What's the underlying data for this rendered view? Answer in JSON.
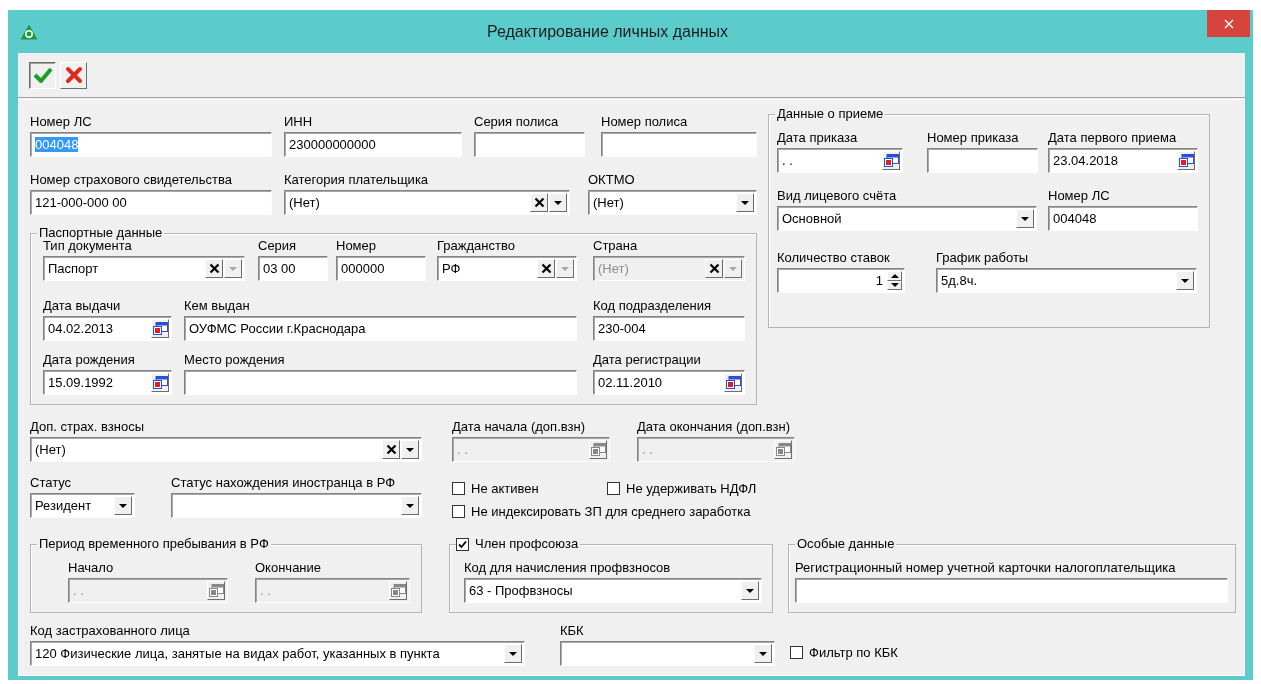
{
  "window": {
    "title": "Редактирование личных данных"
  },
  "main": {
    "lines": [
      {
        "fields": [
          {
            "kind": "text",
            "label": "Номер ЛС",
            "value": "004048",
            "text_selected": true
          },
          {
            "kind": "text",
            "label": "ИНН",
            "value": "230000000000"
          },
          {
            "kind": "text",
            "label": "Серия полиса"
          },
          {
            "kind": "text",
            "label": "Номер полиса"
          }
        ]
      },
      {
        "fields": [
          {
            "kind": "text",
            "label": "Номер страхового свидетельства",
            "value": "121-000-000 00"
          },
          {
            "kind": "combo",
            "label": "Категория плательщика",
            "value": "(Нет)",
            "clear_button": true
          },
          {
            "kind": "combo",
            "label": "ОКТМО",
            "value": "(Нет)"
          }
        ]
      }
    ]
  },
  "passport": {
    "title": "Паспортные данные",
    "lines": [
      {
        "fields": [
          {
            "kind": "combo",
            "label": "Тип документа",
            "value": "Паспорт",
            "clear_button": true,
            "arrow_disabled": true
          },
          {
            "kind": "text",
            "label": "Серия",
            "value": "03 00"
          },
          {
            "kind": "text",
            "label": "Номер",
            "value": "000000"
          },
          {
            "kind": "combo",
            "label": "Гражданство",
            "value": "РФ",
            "clear_button": true,
            "arrow_disabled": true
          },
          {
            "kind": "combo",
            "label": "Страна",
            "value": "(Нет)",
            "clear_button": true,
            "arrow_disabled": true,
            "disabled": true
          }
        ]
      },
      {
        "fields": [
          {
            "kind": "date",
            "label": "Дата выдачи",
            "value": "04.02.2013"
          },
          {
            "kind": "text",
            "label": "Кем выдан",
            "value": "ОУФМС России г.Краснодара"
          },
          {
            "kind": "text",
            "label": "Код подразделения",
            "value": "230-004"
          }
        ]
      },
      {
        "fields": [
          {
            "kind": "date",
            "label": "Дата рождения",
            "value": "15.09.1992"
          },
          {
            "kind": "text",
            "label": "Место рождения"
          },
          {
            "kind": "date",
            "label": "Дата регистрации",
            "value": "02.11.2010"
          }
        ]
      }
    ]
  },
  "hiring": {
    "title": "Данные о приеме",
    "lines": [
      {
        "fields": [
          {
            "kind": "date",
            "label": "Дата приказа",
            "value": ". ."
          },
          {
            "kind": "text",
            "label": "Номер приказа"
          },
          {
            "kind": "date",
            "label": "Дата первого приема",
            "value": "23.04.2018"
          }
        ]
      },
      {
        "fields": [
          {
            "kind": "combo",
            "label": "Вид лицевого счёта",
            "value": "Основной"
          },
          {
            "kind": "text",
            "label": "Номер ЛС",
            "value": "004048"
          }
        ]
      },
      {
        "fields": [
          {
            "kind": "spin",
            "label": "Количество ставок",
            "value": "1"
          },
          {
            "kind": "combo",
            "label": "График работы",
            "value": "5д.8ч."
          }
        ]
      }
    ]
  },
  "contributions": {
    "lines": [
      {
        "fields": [
          {
            "kind": "combo",
            "label": "Доп. страх. взносы",
            "value": "(Нет)",
            "clear_button": true
          },
          {
            "kind": "date",
            "label": "Дата начала (доп.взн)",
            "value": ". .",
            "disabled": true
          },
          {
            "kind": "date",
            "label": "Дата окончания (доп.взн)",
            "value": ". .",
            "disabled": true
          }
        ]
      },
      {
        "fields": [
          {
            "kind": "combo",
            "label": "Статус",
            "value": "Резидент"
          },
          {
            "kind": "combo",
            "label": "Статус нахождения иностранца в РФ"
          }
        ]
      }
    ]
  },
  "flags": [
    {
      "label": "Не активен",
      "checked": false
    },
    {
      "label": "Не удерживать НДФЛ",
      "checked": false
    },
    {
      "label": "Не индексировать ЗП для среднего заработка",
      "checked": false
    }
  ],
  "stay_period": {
    "title": "Период временного пребывания в РФ",
    "lines": [
      {
        "fields": [
          {
            "kind": "date",
            "label": "Начало",
            "value": ". .",
            "disabled": true
          },
          {
            "kind": "date",
            "label": "Окончание",
            "value": ". .",
            "disabled": true
          }
        ]
      }
    ]
  },
  "union": {
    "title": "Член профсоюза",
    "checked": true,
    "lines": [
      {
        "fields": [
          {
            "kind": "combo",
            "label": "Код для начисления профвзносов",
            "value": "63 - Профвзносы"
          }
        ]
      }
    ]
  },
  "special": {
    "title": "Особые данные",
    "lines": [
      {
        "fields": [
          {
            "kind": "text",
            "label": "Регистрационный номер учетной карточки налогоплательщика"
          }
        ]
      }
    ]
  },
  "bottom": {
    "lines": [
      {
        "fields": [
          {
            "kind": "combo",
            "label": "Код застрахованного лица",
            "value": "120 Физические лица, занятые на видах работ, указанных в пункта"
          },
          {
            "kind": "combo",
            "label": "КБК"
          }
        ]
      }
    ],
    "filter": {
      "label": "Фильтр по КБК",
      "checked": false
    }
  }
}
